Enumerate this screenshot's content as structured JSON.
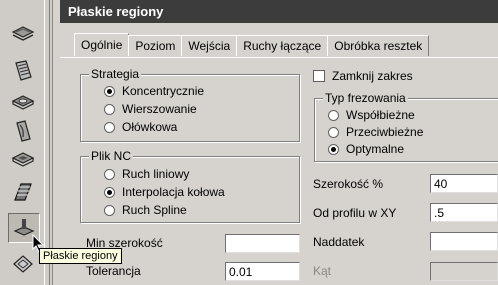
{
  "window": {
    "title": "Płaskie regiony"
  },
  "tabs": [
    {
      "label": "Ogólnie"
    },
    {
      "label": "Poziom"
    },
    {
      "label": "Wejścia"
    },
    {
      "label": "Ruchy łączące"
    },
    {
      "label": "Obróbka resztek"
    }
  ],
  "strategy": {
    "legend": "Strategia",
    "options": [
      {
        "label": "Koncentrycznie",
        "selected": true
      },
      {
        "label": "Wierszowanie",
        "selected": false
      },
      {
        "label": "Ołówkowa",
        "selected": false
      }
    ]
  },
  "nc_file": {
    "legend": "Plik NC",
    "options": [
      {
        "label": "Ruch liniowy",
        "selected": false
      },
      {
        "label": "Interpolacja kołowa",
        "selected": true
      },
      {
        "label": "Ruch Spline",
        "selected": false
      }
    ]
  },
  "close_range": {
    "label": "Zamknij zakres",
    "checked": false
  },
  "milling_type": {
    "legend": "Typ frezowania",
    "options": [
      {
        "label": "Współbieżne",
        "selected": false
      },
      {
        "label": "Przeciwbieżne",
        "selected": false
      },
      {
        "label": "Optymalne",
        "selected": true
      }
    ]
  },
  "fields": {
    "width_pct": {
      "label": "Szerokość %",
      "value": "40"
    },
    "from_profile": {
      "label": "Od profilu w XY",
      "value": ".5"
    },
    "allowance": {
      "label": "Naddatek",
      "value": ""
    },
    "angle": {
      "label": "Kąt",
      "value": ""
    },
    "min_width": {
      "label": "Min szerokość",
      "value": ""
    },
    "tolerance": {
      "label": "Tolerancja",
      "value": "0.01"
    }
  },
  "tooltip": {
    "text": "Płaskie regiony"
  }
}
